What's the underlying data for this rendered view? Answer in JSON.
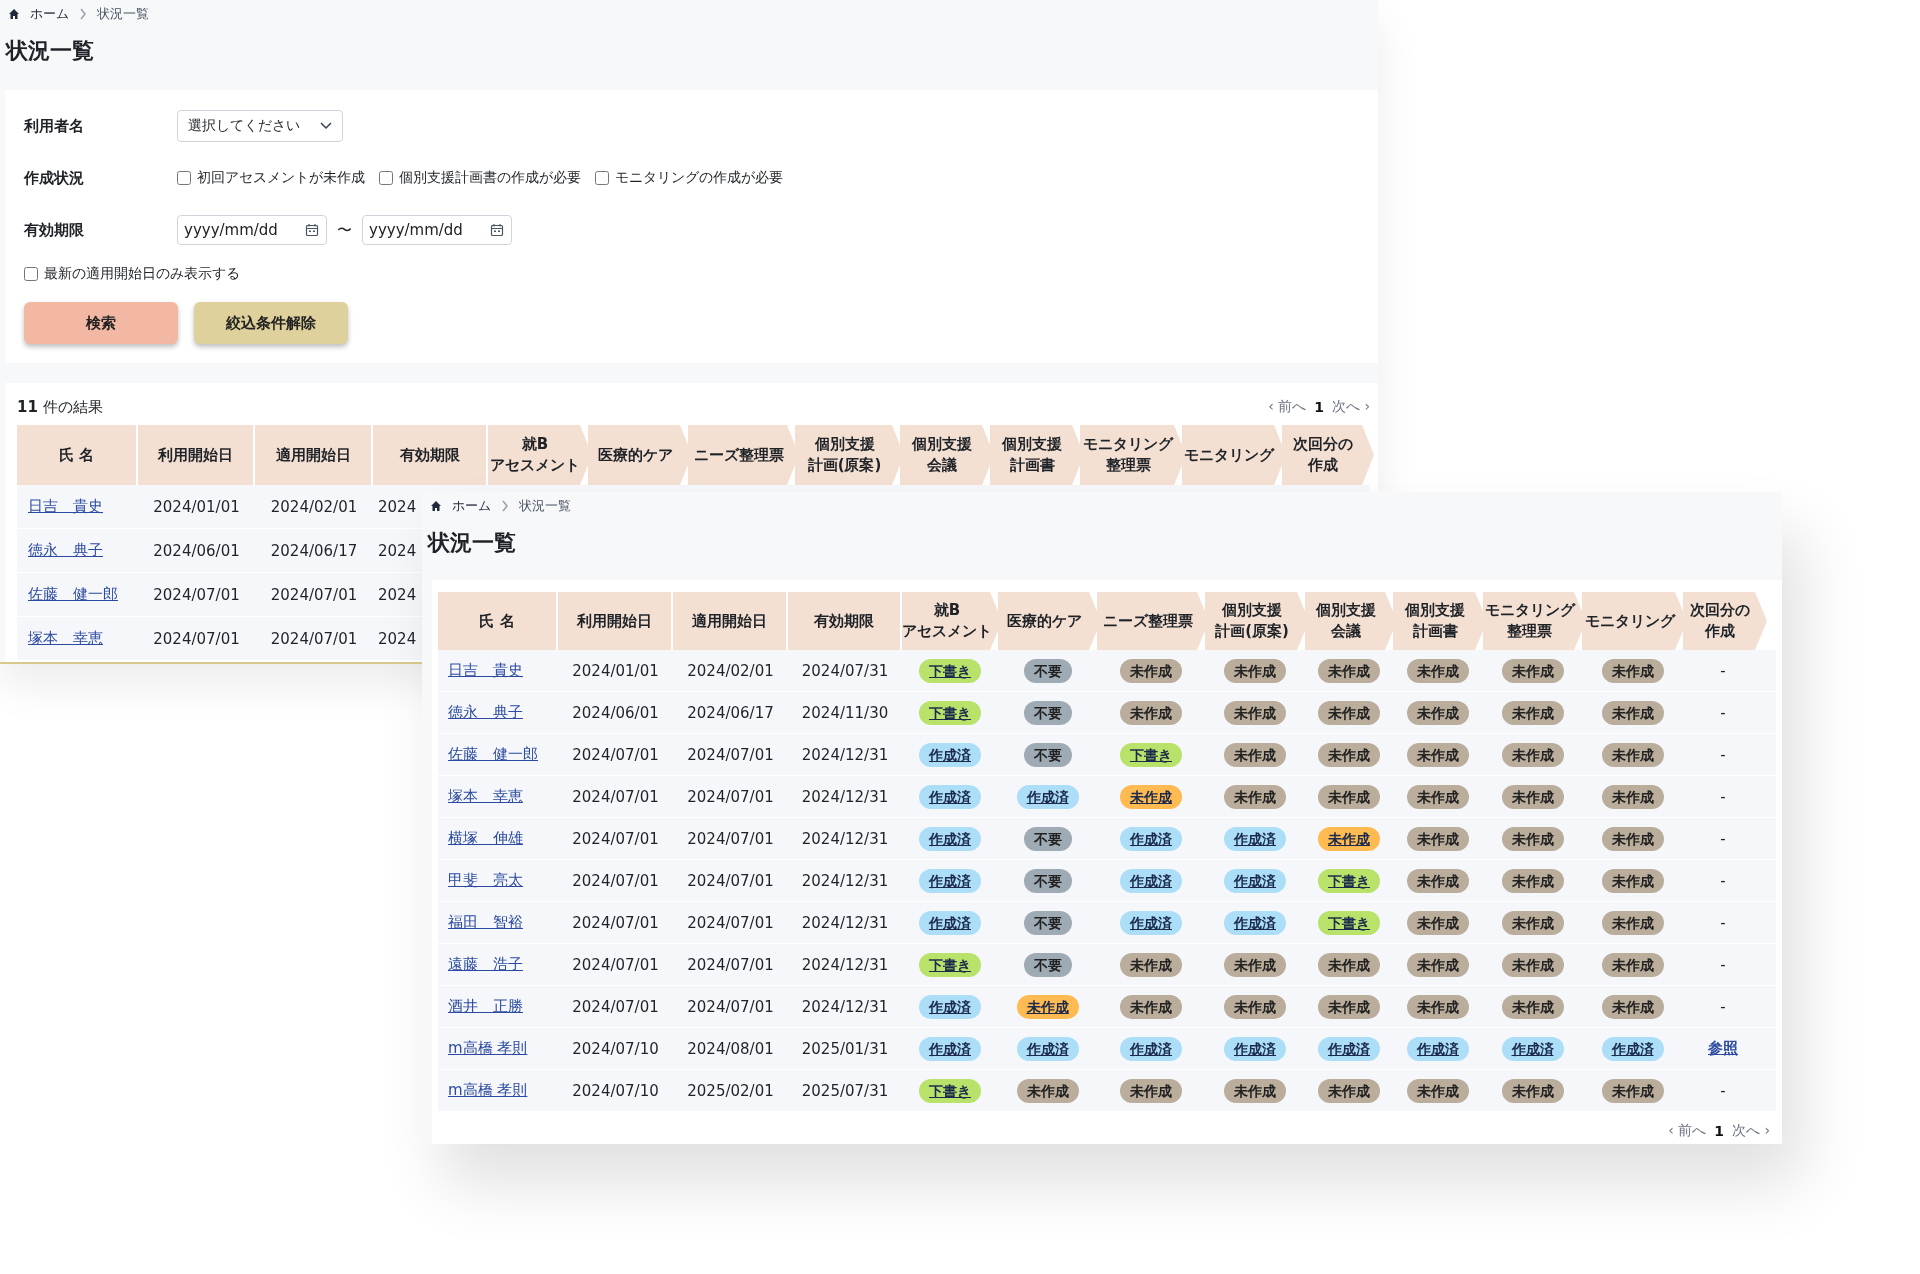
{
  "back_window": {
    "breadcrumb": [
      "ホーム",
      "状況一覧"
    ],
    "title": "状況一覧",
    "filters": {
      "user_label": "利用者名",
      "user_select": "選択してください",
      "status_label": "作成状況",
      "status_options": [
        {
          "label": "初回アセスメントが未作成",
          "checked": false
        },
        {
          "label": "個別支援計画書の作成が必要",
          "checked": false
        },
        {
          "label": "モニタリングの作成が必要",
          "checked": false
        }
      ],
      "expiry_label": "有効期限",
      "date_from": {
        "placeholder": "yyyy/mm/dd"
      },
      "range_separator": "〜",
      "date_to": {
        "placeholder": "yyyy/mm/dd"
      },
      "latest_only": {
        "label": "最新の適用開始日のみ表示する",
        "checked": false
      }
    },
    "buttons": [
      {
        "kind": "search",
        "label": "検索"
      },
      {
        "kind": "clear",
        "label": "絞込条件解除"
      }
    ],
    "result_count": "**11** 件の結果",
    "pagination": {
      "prev": "‹ 前へ",
      "page": "1",
      "next": "次へ ›"
    },
    "table": {
      "columns": [
        {
          "label": "氏 名",
          "kind": "plain"
        },
        {
          "label": "利用開始日",
          "kind": "plain"
        },
        {
          "label": "適用開始日",
          "kind": "plain"
        },
        {
          "label": "有効期限",
          "kind": "plain"
        },
        {
          "label": "就Bアセスメント",
          "kind": "step"
        },
        {
          "label": "医療的ケア",
          "kind": "step"
        },
        {
          "label": "ニーズ整理票",
          "kind": "step"
        },
        {
          "label": "個別支援計画(原案)",
          "kind": "step"
        },
        {
          "label": "個別支援会議",
          "kind": "step"
        },
        {
          "label": "個別支援計画書",
          "kind": "step"
        },
        {
          "label": "モニタリング整理票",
          "kind": "step"
        },
        {
          "label": "モニタリング",
          "kind": "step"
        },
        {
          "label": "次回分の作成",
          "kind": "step"
        }
      ],
      "rows": [
        [
          "日吉　貴史",
          "2024/01/01",
          "2024/02/01",
          "2024"
        ],
        [
          "徳永　典子",
          "2024/06/01",
          "2024/06/17",
          "2024"
        ],
        [
          "佐藤　健一郎",
          "2024/07/01",
          "2024/07/01",
          "2024"
        ],
        [
          "塚本　幸恵",
          "2024/07/01",
          "2024/07/01",
          "2024"
        ]
      ]
    }
  },
  "front_window": {
    "breadcrumb": [
      "ホーム",
      "状況一覧"
    ],
    "title": "状況一覧",
    "table": {
      "columns": [
        {
          "label": "氏 名",
          "kind": "plain"
        },
        {
          "label": "利用開始日",
          "kind": "plain"
        },
        {
          "label": "適用開始日",
          "kind": "plain"
        },
        {
          "label": "有効期限",
          "kind": "plain"
        },
        {
          "label": "就Bアセスメント",
          "kind": "step"
        },
        {
          "label": "医療的ケア",
          "kind": "step"
        },
        {
          "label": "ニーズ整理票",
          "kind": "step"
        },
        {
          "label": "個別支援計画(原案)",
          "kind": "step"
        },
        {
          "label": "個別支援会議",
          "kind": "step"
        },
        {
          "label": "個別支援計画書",
          "kind": "step"
        },
        {
          "label": "モニタリング整理票",
          "kind": "step"
        },
        {
          "label": "モニタリング",
          "kind": "step"
        },
        {
          "label": "次回分の作成",
          "kind": "step"
        }
      ],
      "rows": [
        {
          "name": "日吉　貴史",
          "start": "2024/01/01",
          "apply": "2024/02/01",
          "expiry": "2024/07/31",
          "statuses": [
            {
              "kind": "draft",
              "label": "下書き"
            },
            {
              "kind": "none",
              "label": "不要"
            },
            {
              "kind": "todo",
              "label": "未作成"
            },
            {
              "kind": "todo",
              "label": "未作成"
            },
            {
              "kind": "todo",
              "label": "未作成"
            },
            {
              "kind": "todo",
              "label": "未作成"
            },
            {
              "kind": "todo",
              "label": "未作成"
            },
            {
              "kind": "todo",
              "label": "未作成"
            }
          ],
          "next": {
            "kind": "dash",
            "label": "-"
          }
        },
        {
          "name": "徳永　典子",
          "start": "2024/06/01",
          "apply": "2024/06/17",
          "expiry": "2024/11/30",
          "statuses": [
            {
              "kind": "draft",
              "label": "下書き"
            },
            {
              "kind": "none",
              "label": "不要"
            },
            {
              "kind": "todo",
              "label": "未作成"
            },
            {
              "kind": "todo",
              "label": "未作成"
            },
            {
              "kind": "todo",
              "label": "未作成"
            },
            {
              "kind": "todo",
              "label": "未作成"
            },
            {
              "kind": "todo",
              "label": "未作成"
            },
            {
              "kind": "todo",
              "label": "未作成"
            }
          ],
          "next": {
            "kind": "dash",
            "label": "-"
          }
        },
        {
          "name": "佐藤　健一郎",
          "start": "2024/07/01",
          "apply": "2024/07/01",
          "expiry": "2024/12/31",
          "statuses": [
            {
              "kind": "done",
              "label": "作成済"
            },
            {
              "kind": "none",
              "label": "不要"
            },
            {
              "kind": "draft",
              "label": "下書き"
            },
            {
              "kind": "todo",
              "label": "未作成"
            },
            {
              "kind": "todo",
              "label": "未作成"
            },
            {
              "kind": "todo",
              "label": "未作成"
            },
            {
              "kind": "todo",
              "label": "未作成"
            },
            {
              "kind": "todo",
              "label": "未作成"
            }
          ],
          "next": {
            "kind": "dash",
            "label": "-"
          }
        },
        {
          "name": "塚本　幸恵",
          "start": "2024/07/01",
          "apply": "2024/07/01",
          "expiry": "2024/12/31",
          "statuses": [
            {
              "kind": "done",
              "label": "作成済"
            },
            {
              "kind": "done",
              "label": "作成済"
            },
            {
              "kind": "alert",
              "label": "未作成"
            },
            {
              "kind": "todo",
              "label": "未作成"
            },
            {
              "kind": "todo",
              "label": "未作成"
            },
            {
              "kind": "todo",
              "label": "未作成"
            },
            {
              "kind": "todo",
              "label": "未作成"
            },
            {
              "kind": "todo",
              "label": "未作成"
            }
          ],
          "next": {
            "kind": "dash",
            "label": "-"
          }
        },
        {
          "name": "横塚　伸雄",
          "start": "2024/07/01",
          "apply": "2024/07/01",
          "expiry": "2024/12/31",
          "statuses": [
            {
              "kind": "done",
              "label": "作成済"
            },
            {
              "kind": "none",
              "label": "不要"
            },
            {
              "kind": "done",
              "label": "作成済"
            },
            {
              "kind": "done",
              "label": "作成済"
            },
            {
              "kind": "alert",
              "label": "未作成"
            },
            {
              "kind": "todo",
              "label": "未作成"
            },
            {
              "kind": "todo",
              "label": "未作成"
            },
            {
              "kind": "todo",
              "label": "未作成"
            }
          ],
          "next": {
            "kind": "dash",
            "label": "-"
          }
        },
        {
          "name": "甲斐　亮太",
          "start": "2024/07/01",
          "apply": "2024/07/01",
          "expiry": "2024/12/31",
          "statuses": [
            {
              "kind": "done",
              "label": "作成済"
            },
            {
              "kind": "none",
              "label": "不要"
            },
            {
              "kind": "done",
              "label": "作成済"
            },
            {
              "kind": "done",
              "label": "作成済"
            },
            {
              "kind": "draft",
              "label": "下書き"
            },
            {
              "kind": "todo",
              "label": "未作成"
            },
            {
              "kind": "todo",
              "label": "未作成"
            },
            {
              "kind": "todo",
              "label": "未作成"
            }
          ],
          "next": {
            "kind": "dash",
            "label": "-"
          }
        },
        {
          "name": "福田　智裕",
          "start": "2024/07/01",
          "apply": "2024/07/01",
          "expiry": "2024/12/31",
          "statuses": [
            {
              "kind": "done",
              "label": "作成済"
            },
            {
              "kind": "none",
              "label": "不要"
            },
            {
              "kind": "done",
              "label": "作成済"
            },
            {
              "kind": "done",
              "label": "作成済"
            },
            {
              "kind": "draft",
              "label": "下書き"
            },
            {
              "kind": "todo",
              "label": "未作成"
            },
            {
              "kind": "todo",
              "label": "未作成"
            },
            {
              "kind": "todo",
              "label": "未作成"
            }
          ],
          "next": {
            "kind": "dash",
            "label": "-"
          }
        },
        {
          "name": "遠藤　浩子",
          "start": "2024/07/01",
          "apply": "2024/07/01",
          "expiry": "2024/12/31",
          "statuses": [
            {
              "kind": "draft",
              "label": "下書き"
            },
            {
              "kind": "none",
              "label": "不要"
            },
            {
              "kind": "todo",
              "label": "未作成"
            },
            {
              "kind": "todo",
              "label": "未作成"
            },
            {
              "kind": "todo",
              "label": "未作成"
            },
            {
              "kind": "todo",
              "label": "未作成"
            },
            {
              "kind": "todo",
              "label": "未作成"
            },
            {
              "kind": "todo",
              "label": "未作成"
            }
          ],
          "next": {
            "kind": "dash",
            "label": "-"
          }
        },
        {
          "name": "酒井　正勝",
          "start": "2024/07/01",
          "apply": "2024/07/01",
          "expiry": "2024/12/31",
          "statuses": [
            {
              "kind": "done",
              "label": "作成済"
            },
            {
              "kind": "alert",
              "label": "未作成"
            },
            {
              "kind": "todo",
              "label": "未作成"
            },
            {
              "kind": "todo",
              "label": "未作成"
            },
            {
              "kind": "todo",
              "label": "未作成"
            },
            {
              "kind": "todo",
              "label": "未作成"
            },
            {
              "kind": "todo",
              "label": "未作成"
            },
            {
              "kind": "todo",
              "label": "未作成"
            }
          ],
          "next": {
            "kind": "dash",
            "label": "-"
          }
        },
        {
          "name": "m高橋 孝則",
          "start": "2024/07/10",
          "apply": "2024/08/01",
          "expiry": "2025/01/31",
          "statuses": [
            {
              "kind": "done",
              "label": "作成済"
            },
            {
              "kind": "done",
              "label": "作成済"
            },
            {
              "kind": "done",
              "label": "作成済"
            },
            {
              "kind": "done",
              "label": "作成済"
            },
            {
              "kind": "done",
              "label": "作成済"
            },
            {
              "kind": "done",
              "label": "作成済"
            },
            {
              "kind": "done",
              "label": "作成済"
            },
            {
              "kind": "done",
              "label": "作成済"
            }
          ],
          "next": {
            "kind": "link",
            "label": "参照"
          }
        },
        {
          "name": "m高橋 孝則",
          "start": "2024/07/10",
          "apply": "2025/02/01",
          "expiry": "2025/07/31",
          "statuses": [
            {
              "kind": "draft",
              "label": "下書き"
            },
            {
              "kind": "todo",
              "label": "未作成"
            },
            {
              "kind": "todo",
              "label": "未作成"
            },
            {
              "kind": "todo",
              "label": "未作成"
            },
            {
              "kind": "todo",
              "label": "未作成"
            },
            {
              "kind": "todo",
              "label": "未作成"
            },
            {
              "kind": "todo",
              "label": "未作成"
            },
            {
              "kind": "todo",
              "label": "未作成"
            }
          ],
          "next": {
            "kind": "dash",
            "label": "-"
          }
        }
      ]
    },
    "pagination": {
      "prev": "‹ 前へ",
      "page": "1",
      "next": "次へ ›"
    }
  }
}
